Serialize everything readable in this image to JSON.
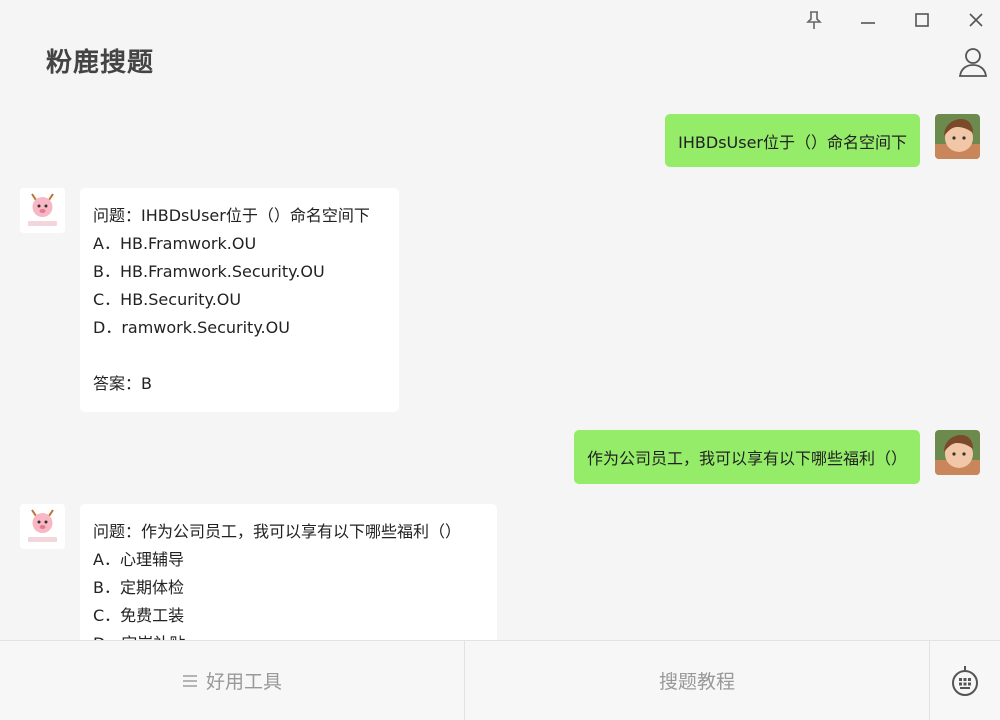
{
  "app": {
    "title": "粉鹿搜题"
  },
  "window_controls": {
    "pin": "pin-icon",
    "minimize": "minimize-icon",
    "maximize": "maximize-icon",
    "close": "close-icon"
  },
  "messages": [
    {
      "side": "out",
      "text": "IHBDsUser位于（）命名空间下"
    },
    {
      "side": "in",
      "lines": [
        "问题：IHBDsUser位于（）命名空间下",
        "A．HB.Framwork.OU",
        "B．HB.Framwork.Security.OU",
        "C．HB.Security.OU",
        "D．ramwork.Security.OU"
      ],
      "answer": "答案：B"
    },
    {
      "side": "out",
      "text": "作为公司员工，我可以享有以下哪些福利（）"
    },
    {
      "side": "in",
      "lines": [
        "问题：作为公司员工，我可以享有以下哪些福利（）",
        "A．心理辅导",
        "B．定期体检",
        "C．免费工装",
        "D．定岗补贴"
      ]
    }
  ],
  "bottom_bar": {
    "tools_label": "好用工具",
    "tutorial_label": "搜题教程",
    "keypad_icon": "keypad-icon"
  },
  "colors": {
    "outgoing_bubble": "#95ec69",
    "incoming_bubble": "#ffffff",
    "background": "#f5f5f5"
  }
}
